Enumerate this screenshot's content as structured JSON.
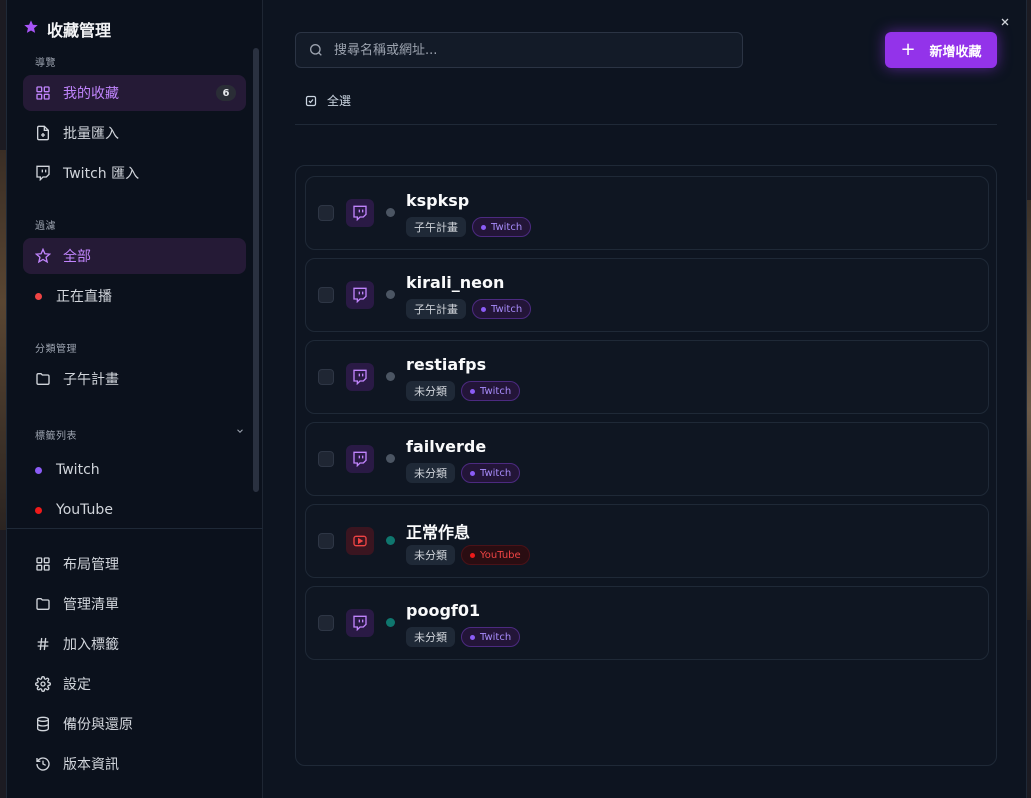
{
  "colors": {
    "accent": "#9333ea",
    "twitch": "#a855f7",
    "youtube": "#ef4444",
    "offline": "#6b7280",
    "online": "#10b981"
  },
  "sidebar": {
    "title": "收藏管理",
    "title_icon": "star-icon",
    "sections": {
      "nav": "導覽",
      "filter": "過濾",
      "category": "分類管理",
      "tags": "標籤列表"
    },
    "nav_items": [
      {
        "label": "我的收藏",
        "icon": "grid-icon",
        "badge": "6",
        "active": true
      },
      {
        "label": "批量匯入",
        "icon": "file-plus-icon"
      },
      {
        "label": "Twitch 匯入",
        "icon": "twitch-icon"
      }
    ],
    "filter_items": [
      {
        "label": "全部",
        "icon": "star-outline-icon",
        "active": true
      },
      {
        "label": "正在直播",
        "icon": "red-dot"
      }
    ],
    "category_items": [
      {
        "label": "子午計畫",
        "icon": "folder-icon"
      }
    ],
    "tag_items": [
      {
        "label": "Twitch",
        "color": "#8b5cf6"
      },
      {
        "label": "YouTube",
        "color": "#ef1a1a"
      }
    ],
    "bottom_items": [
      {
        "label": "布局管理",
        "icon": "grid-icon"
      },
      {
        "label": "管理清單",
        "icon": "folder-icon"
      },
      {
        "label": "加入標籤",
        "icon": "hash-icon"
      },
      {
        "label": "設定",
        "icon": "gear-icon"
      },
      {
        "label": "備份與還原",
        "icon": "database-icon"
      },
      {
        "label": "版本資訊",
        "icon": "history-icon"
      }
    ]
  },
  "main": {
    "search_placeholder": "搜尋名稱或網址...",
    "add_button": "新增收藏",
    "select_all": "全選",
    "items": [
      {
        "name": "kspksp",
        "category": "子午計畫",
        "platform": "Twitch",
        "live": false
      },
      {
        "name": "kirali_neon",
        "category": "子午計畫",
        "platform": "Twitch",
        "live": false
      },
      {
        "name": "restiafps",
        "category": "未分類",
        "platform": "Twitch",
        "live": false
      },
      {
        "name": "failverde",
        "category": "未分類",
        "platform": "Twitch",
        "live": false
      },
      {
        "name": "正常作息",
        "category": "未分類",
        "platform": "YouTube",
        "live": true
      },
      {
        "name": "poogf01",
        "category": "未分類",
        "platform": "Twitch",
        "live": true
      }
    ]
  }
}
